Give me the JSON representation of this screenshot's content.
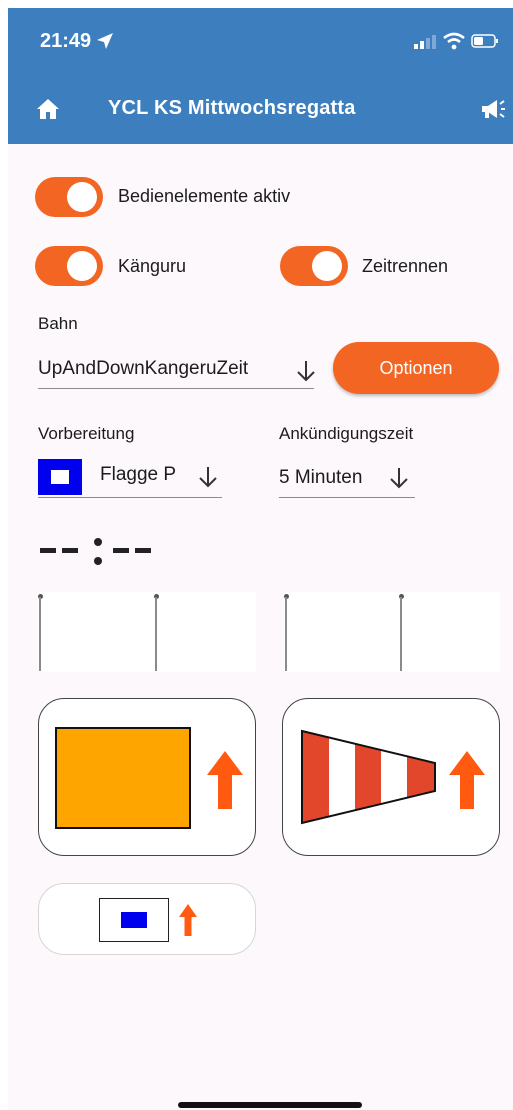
{
  "status_bar": {
    "time": "21:49"
  },
  "app_bar": {
    "title": "YCL KS Mittwochsregatta"
  },
  "toggles": {
    "controls_active": {
      "label": "Bedienelemente aktiv",
      "on": true
    },
    "kangaroo": {
      "label": "Känguru",
      "on": true
    },
    "time_separation": {
      "label": "Zeitrennen",
      "on": true
    }
  },
  "course": {
    "label": "Bahn",
    "value": "UpAndDownKangeruZeit",
    "options_button": "Optionen"
  },
  "preparation": {
    "label": "Vorbereitung",
    "value": "Flagge P",
    "flag_icon": "flag-papa-icon"
  },
  "announcement": {
    "label": "Ankündigungszeit",
    "value": "5 Minuten"
  },
  "countdown": {
    "display": "--:--"
  },
  "colors": {
    "primary": "#3d7ebf",
    "accent": "#f26522",
    "flag_orange": "#ffa500",
    "windsock_red": "#e2472c",
    "flag_blue": "#0000ee"
  },
  "action_cards": [
    {
      "icon": "orange-flag-icon",
      "action_icon": "arrow-up-icon"
    },
    {
      "icon": "windsock-icon",
      "action_icon": "arrow-up-icon"
    },
    {
      "icon": "flag-papa-icon",
      "action_icon": "arrow-up-icon"
    }
  ]
}
